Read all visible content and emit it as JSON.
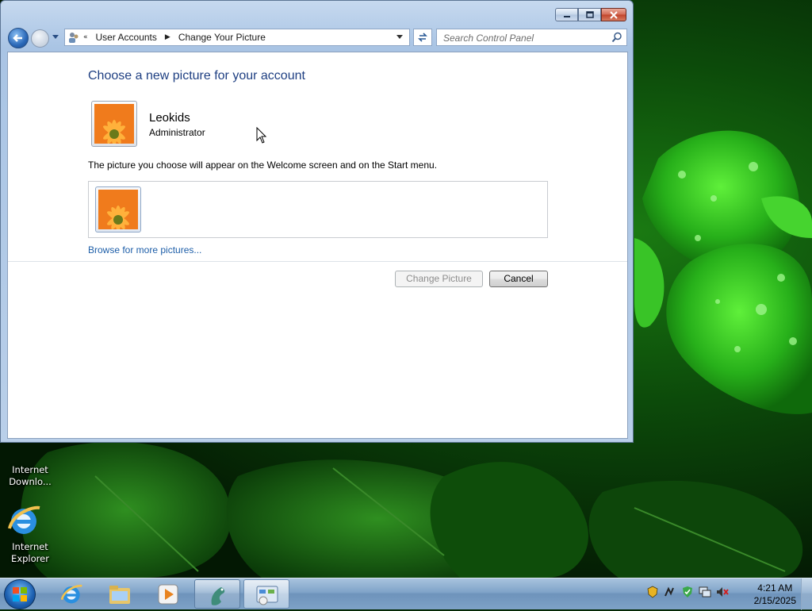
{
  "window": {
    "controls": [
      "minimize",
      "maximize",
      "close"
    ]
  },
  "navbar": {
    "breadcrumb_chevron": "«",
    "breadcrumb": [
      "User Accounts",
      "Change Your Picture"
    ],
    "search_placeholder": "Search Control Panel"
  },
  "content": {
    "title": "Choose a new picture for your account",
    "user_name": "Leokids",
    "user_role": "Administrator",
    "hint": "The picture you choose will appear on the Welcome screen and on the Start menu.",
    "browse_link": "Browse for more pictures...",
    "change_button": "Change Picture",
    "cancel_button": "Cancel",
    "change_button_enabled": false
  },
  "desktop": {
    "icons": [
      {
        "label_line1": "Internet",
        "label_line2": "Downlo...",
        "icon": "internet-download-manager-icon"
      },
      {
        "label_line1": "Internet",
        "label_line2": "Explorer",
        "icon": "internet-explorer-icon"
      }
    ]
  },
  "taskbar": {
    "start": "windows-start-orb",
    "pinned": [
      "internet-explorer-icon",
      "file-explorer-icon",
      "media-player-icon",
      "dragon-app-icon",
      "control-panel-icon"
    ],
    "tray_icons": [
      "action-center-icon",
      "network-activity-icon",
      "security-shield-icon",
      "network-icon",
      "volume-muted-icon"
    ],
    "time": "4:21 AM",
    "date": "2/15/2025"
  },
  "colors": {
    "title": "#1e3f82",
    "link": "#1d5ea8",
    "window_frame": "#b9cfe9"
  }
}
